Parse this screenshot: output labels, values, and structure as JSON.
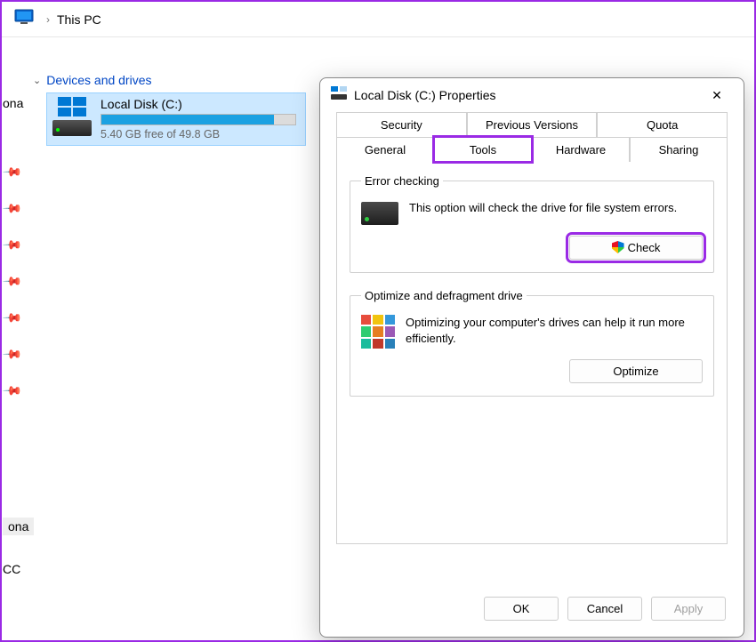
{
  "breadcrumb": {
    "location": "This PC"
  },
  "sidebar_fragments": {
    "ona": "ona",
    "ona2": "ona",
    "cc": "CC"
  },
  "section": {
    "title": "Devices and drives"
  },
  "drive": {
    "name": "Local Disk (C:)",
    "free_text": "5.40 GB free of 49.8 GB",
    "fill_percent": 89
  },
  "dialog": {
    "title": "Local Disk (C:) Properties",
    "tabs_row1": [
      "Security",
      "Previous Versions",
      "Quota"
    ],
    "tabs_row2": [
      "General",
      "Tools",
      "Hardware",
      "Sharing"
    ],
    "active_tab": "Tools",
    "error_check": {
      "legend": "Error checking",
      "text": "This option will check the drive for file system errors.",
      "button": "Check"
    },
    "optimize": {
      "legend": "Optimize and defragment drive",
      "text": "Optimizing your computer's drives can help it run more efficiently.",
      "button": "Optimize"
    },
    "buttons": {
      "ok": "OK",
      "cancel": "Cancel",
      "apply": "Apply"
    }
  }
}
